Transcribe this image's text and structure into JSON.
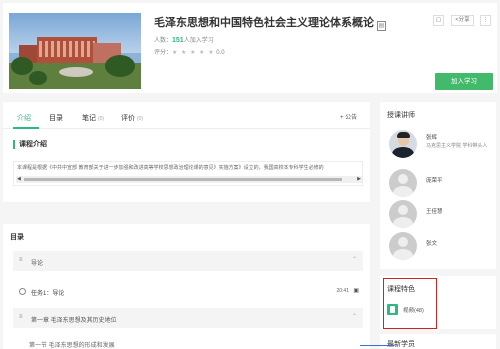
{
  "course": {
    "title": "毛泽东思想和中国特色社会主义理论体系概论",
    "enroll_prefix": "人数：",
    "enroll_count": "151",
    "enroll_suffix": "人加入学习",
    "rating_label": "评分：",
    "rating_stars": "★ ★ ★ ★ ★",
    "rating_value": "0.0",
    "collect_icon": "bookmark-icon",
    "share_label": "分享",
    "more_label": "⋮",
    "join_button": "加入学习"
  },
  "tabs": [
    {
      "label": "介绍",
      "count": ""
    },
    {
      "label": "目录",
      "count": ""
    },
    {
      "label": "笔记",
      "count": "(0)"
    },
    {
      "label": "评价",
      "count": "(0)"
    }
  ],
  "announce_label": "+ 公告",
  "intro": {
    "heading": "课程介绍",
    "text": "本课程是根据《中共中宣部 教育部关于进一步加强和改进高等学校思想政治理论课的意见》实施方案》设立的，我国高校本专科学生必修的"
  },
  "catalog": {
    "heading": "目录",
    "chapters": [
      {
        "label": "导论"
      },
      {
        "label": "第一章 毛泽东思想及其历史地位"
      }
    ],
    "tasks": [
      {
        "label": "任务1：导论",
        "duration": "20:41"
      }
    ],
    "subsection": "第一节 毛泽东思想的形成和发展"
  },
  "teachers": {
    "heading": "授课讲师",
    "items": [
      {
        "name": "张辉",
        "desc": "马克思主义学院 学科带头人"
      },
      {
        "name": "庞荣平",
        "desc": ""
      },
      {
        "name": "王佳慧",
        "desc": ""
      },
      {
        "name": "张文",
        "desc": ""
      }
    ]
  },
  "features": {
    "heading": "课程特色",
    "item_label": "视频(48)",
    "item_icon": "video-doc-icon"
  },
  "learners": {
    "heading": "最新学员"
  },
  "colors": {
    "accent": "#2eb886",
    "join_button": "#43b96b",
    "highlight_box": "#d62020"
  }
}
